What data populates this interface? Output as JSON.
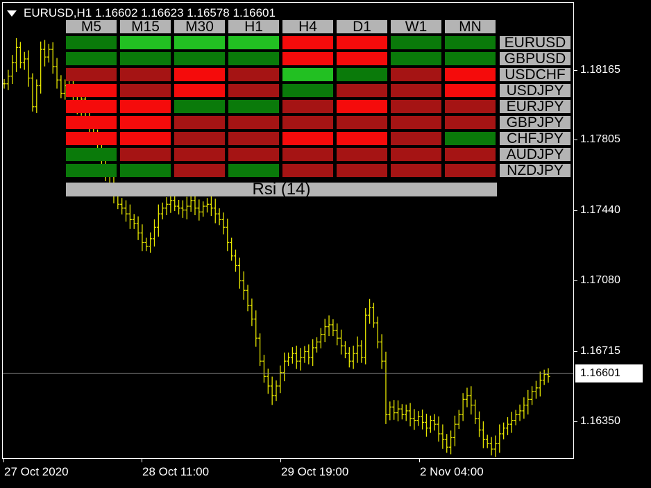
{
  "title": "EURUSD,H1  1.16602 1.16623 1.16578 1.16601",
  "current_price": "1.16601",
  "price_axis": {
    "labels": [
      "1.18165",
      "1.17805",
      "1.17440",
      "1.17080",
      "1.16715",
      "1.16350"
    ]
  },
  "time_axis": {
    "labels": [
      "27 Oct 2020",
      "28 Oct 11:00",
      "29 Oct 19:00",
      "2 Nov 04:00"
    ]
  },
  "colors": {
    "background": "#000000",
    "bars": "#e6e600",
    "current_line": "#8c8c8c",
    "strong_up": "#22c022",
    "up": "#0a7a0a",
    "strong_down": "#f50b0b",
    "down": "#a51414",
    "panel_gray": "#b4b4b4"
  },
  "rsi_panel": {
    "timeframes": [
      "M5",
      "M15",
      "M30",
      "H1",
      "H4",
      "D1",
      "W1",
      "MN"
    ],
    "pairs": [
      "EURUSD",
      "GBPUSD",
      "USDCHF",
      "USDJPY",
      "EURJPY",
      "GBPJPY",
      "CHFJPY",
      "AUDJPY",
      "NZDJPY"
    ],
    "footer": "Rsi (14)",
    "states": [
      [
        "up",
        "strong_up",
        "strong_up",
        "strong_up",
        "strong_down",
        "strong_down",
        "up",
        "up"
      ],
      [
        "up",
        "up",
        "up",
        "up",
        "strong_down",
        "strong_down",
        "up",
        "up"
      ],
      [
        "down",
        "down",
        "strong_down",
        "down",
        "strong_up",
        "up",
        "down",
        "strong_down"
      ],
      [
        "strong_down",
        "down",
        "strong_down",
        "down",
        "up",
        "down",
        "down",
        "strong_down"
      ],
      [
        "strong_down",
        "strong_down",
        "up",
        "up",
        "down",
        "strong_down",
        "down",
        "down"
      ],
      [
        "strong_down",
        "strong_down",
        "down",
        "down",
        "down",
        "down",
        "down",
        "down"
      ],
      [
        "strong_down",
        "strong_down",
        "down",
        "down",
        "strong_down",
        "strong_down",
        "down",
        "up"
      ],
      [
        "up",
        "down",
        "down",
        "down",
        "down",
        "down",
        "down",
        "down"
      ],
      [
        "up",
        "up",
        "down",
        "up",
        "down",
        "down",
        "down",
        "down"
      ]
    ]
  },
  "chart_data": {
    "type": "ohlc",
    "symbol": "EURUSD",
    "timeframe": "H1",
    "ohlc_last": {
      "open": 1.16602,
      "high": 1.16623,
      "low": 1.16578,
      "close": 1.16601
    },
    "y_ticks": [
      1.18165,
      1.17805,
      1.1744,
      1.1708,
      1.16715,
      1.1635
    ],
    "x_ticks": [
      "27 Oct 2020",
      "28 Oct 11:00",
      "29 Oct 19:00",
      "2 Nov 04:00"
    ],
    "ylim": [
      1.1618,
      1.1855
    ],
    "close_path": [
      1.1813,
      1.1817,
      1.1824,
      1.1832,
      1.1824,
      1.1826,
      1.1816,
      1.1801,
      1.1812,
      1.1831,
      1.1827,
      1.1831,
      1.1822,
      1.1815,
      1.1808,
      1.1812,
      1.1815,
      1.1808,
      1.18,
      1.1805,
      1.1798,
      1.179,
      1.1785,
      1.1778,
      1.177,
      1.1765,
      1.176,
      1.1755,
      1.175,
      1.1748,
      1.1745,
      1.1742,
      1.174,
      1.1735,
      1.173,
      1.1728,
      1.1732,
      1.1738,
      1.1745,
      1.1748,
      1.175,
      1.1752,
      1.1749,
      1.1748,
      1.1747,
      1.1749,
      1.1752,
      1.1748,
      1.1746,
      1.1749,
      1.175,
      1.1748,
      1.1745,
      1.1742,
      1.1738,
      1.173,
      1.1723,
      1.1718,
      1.171,
      1.1705,
      1.1697,
      1.169,
      1.168,
      1.1668,
      1.166,
      1.1655,
      1.165,
      1.1655,
      1.1662,
      1.1668,
      1.167,
      1.1672,
      1.1668,
      1.167,
      1.1673,
      1.167,
      1.1675,
      1.1678,
      1.1682,
      1.1686,
      1.1687,
      1.1684,
      1.168,
      1.1676,
      1.1672,
      1.1668,
      1.1672,
      1.1676,
      1.167,
      1.1692,
      1.1696,
      1.1688,
      1.1678,
      1.1668,
      1.164,
      1.1644,
      1.1641,
      1.1643,
      1.164,
      1.1642,
      1.1638,
      1.1637,
      1.1639,
      1.1636,
      1.1633,
      1.1637,
      1.1635,
      1.163,
      1.1627,
      1.1623,
      1.1628,
      1.1635,
      1.164,
      1.1648,
      1.165,
      1.1645,
      1.1638,
      1.1632,
      1.1627,
      1.1625,
      1.1622,
      1.1625,
      1.163,
      1.1633,
      1.1635,
      1.1637,
      1.164,
      1.1642,
      1.1645,
      1.1648,
      1.1652,
      1.1654,
      1.1658,
      1.1661,
      1.166
    ]
  }
}
